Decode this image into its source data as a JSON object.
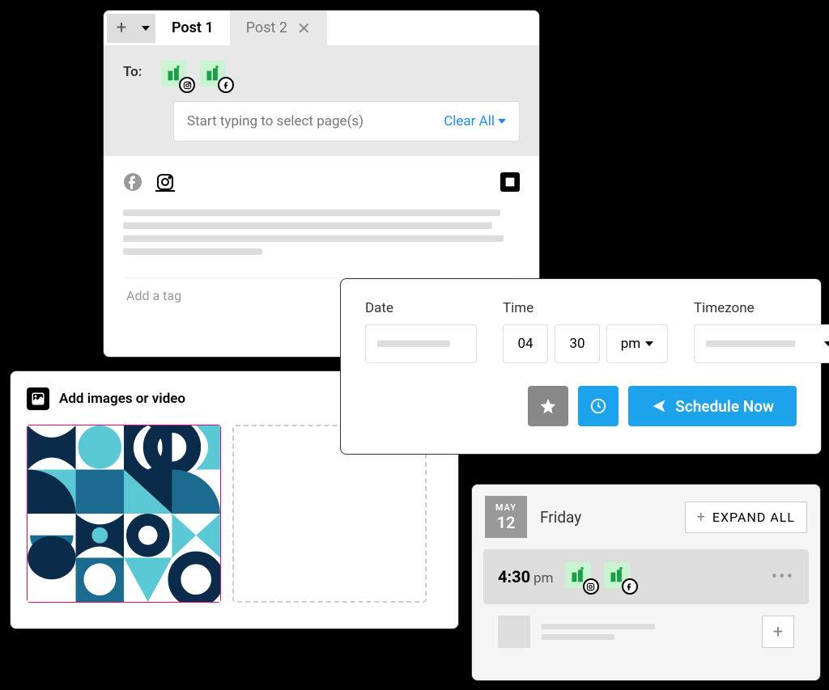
{
  "composer": {
    "tabs": [
      {
        "label": "Post 1",
        "active": true
      },
      {
        "label": "Post 2",
        "active": false
      }
    ],
    "to_label": "To:",
    "page_placeholder": "Start typing to select page(s)",
    "clear_all": "Clear All",
    "tag_placeholder": "Add a tag",
    "avatars": [
      {
        "platform": "instagram"
      },
      {
        "platform": "facebook"
      }
    ],
    "platform_tabs": [
      {
        "name": "facebook",
        "active": false
      },
      {
        "name": "instagram",
        "active": true
      }
    ]
  },
  "media": {
    "header": "Add images or video"
  },
  "schedule": {
    "date_label": "Date",
    "time_label": "Time",
    "tz_label": "Timezone",
    "hour": "04",
    "minute": "30",
    "ampm": "pm",
    "button": "Schedule Now"
  },
  "calendar": {
    "month": "MAY",
    "day": "12",
    "dayname": "Friday",
    "expand": "EXPAND ALL",
    "entry_time": "4:30",
    "entry_suffix": "pm",
    "entry_avatars": [
      {
        "platform": "instagram"
      },
      {
        "platform": "facebook"
      }
    ]
  }
}
